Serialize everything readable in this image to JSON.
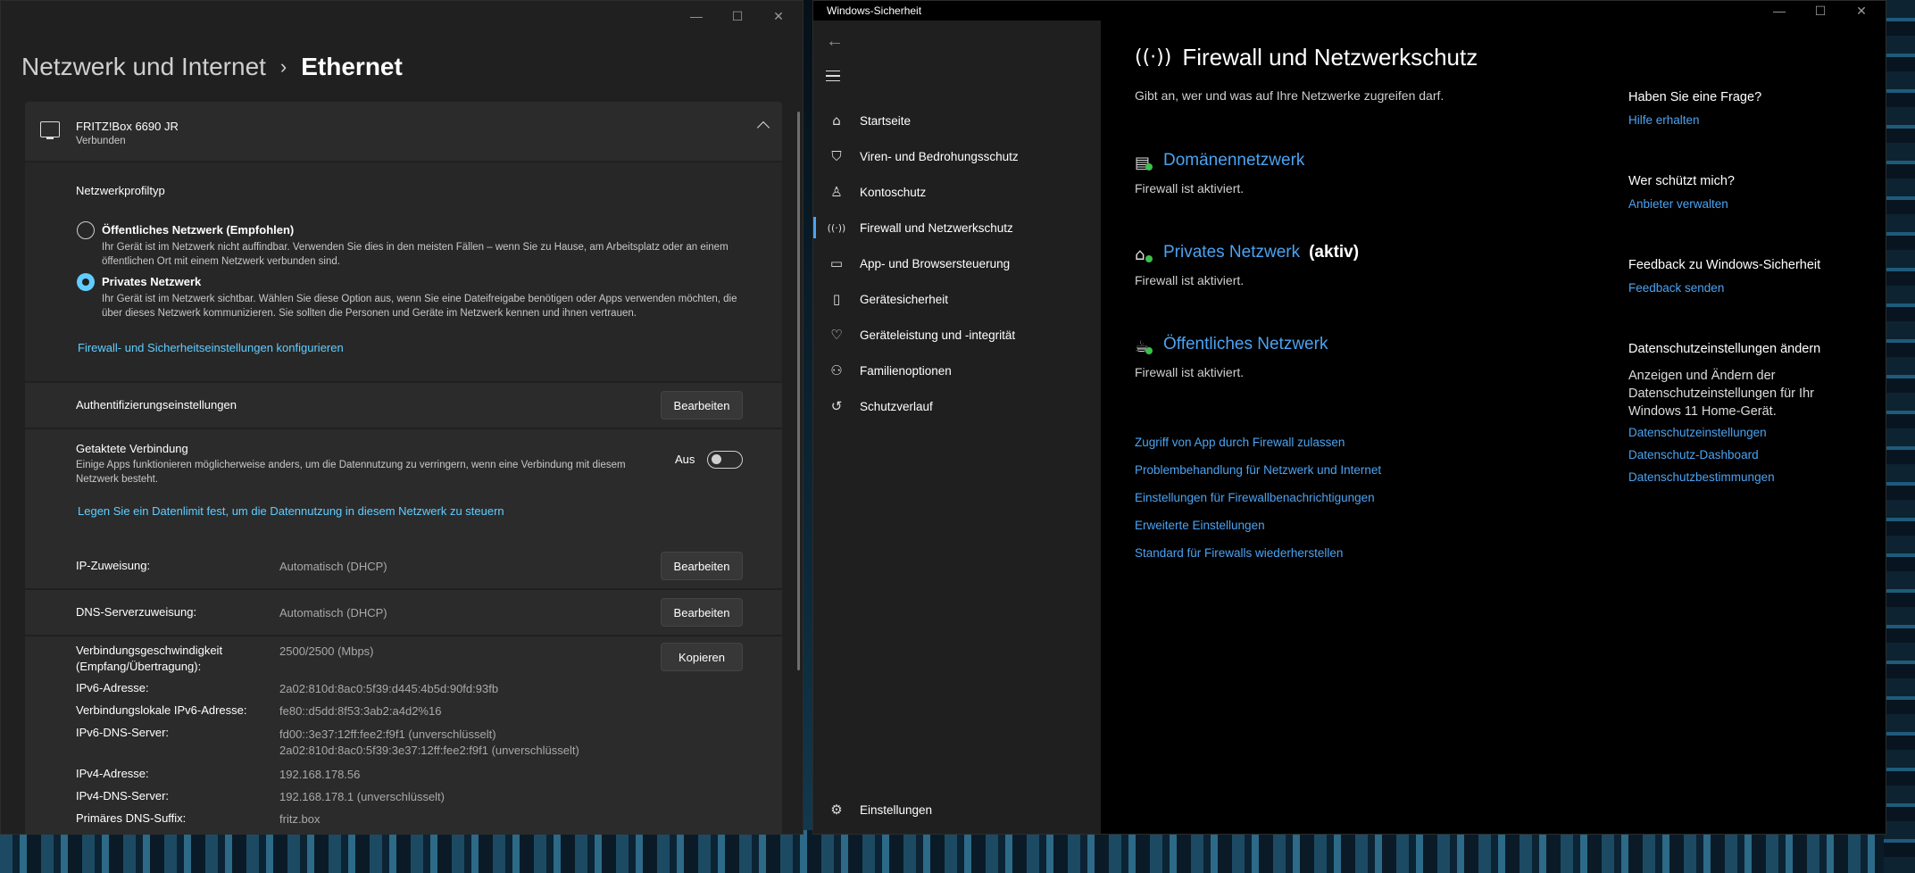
{
  "settings": {
    "breadcrumb_parent": "Netzwerk und Internet",
    "breadcrumb_sep": "›",
    "breadcrumb_current": "Ethernet",
    "caption": {
      "minimize": "—",
      "maximize": "☐",
      "close": "✕"
    },
    "adapter": {
      "name": "FRITZ!Box 6690 JR",
      "status": "Verbunden"
    },
    "profile": {
      "heading": "Netzwerkprofiltyp",
      "options": [
        {
          "title": "Öffentliches Netzwerk (Empfohlen)",
          "desc": "Ihr Gerät ist im Netzwerk nicht auffindbar. Verwenden Sie dies in den meisten Fällen – wenn Sie zu Hause, am Arbeitsplatz oder an einem öffentlichen Ort mit einem Netzwerk verbunden sind.",
          "selected": false
        },
        {
          "title": "Privates Netzwerk",
          "desc": "Ihr Gerät ist im Netzwerk sichtbar. Wählen Sie diese Option aus, wenn Sie eine Dateifreigabe benötigen oder Apps verwenden möchten, die über dieses Netzwerk kommunizieren. Sie sollten die Personen und Geräte im Netzwerk kennen und ihnen vertrauen.",
          "selected": true
        }
      ],
      "firewall_link": "Firewall- und Sicherheitseinstellungen konfigurieren"
    },
    "auth": {
      "label": "Authentifizierungseinstellungen",
      "button": "Bearbeiten"
    },
    "metered": {
      "label": "Getaktete Verbindung",
      "desc": "Einige Apps funktionieren möglicherweise anders, um die Datennutzung zu verringern, wenn eine Verbindung mit diesem Netzwerk besteht.",
      "toggle_label": "Aus",
      "toggle_on": false,
      "link": "Legen Sie ein Datenlimit fest, um die Datennutzung in diesem Netzwerk zu steuern"
    },
    "ip": {
      "label": "IP-Zuweisung:",
      "value": "Automatisch (DHCP)",
      "button": "Bearbeiten"
    },
    "dns": {
      "label": "DNS-Serverzuweisung:",
      "value": "Automatisch (DHCP)",
      "button": "Bearbeiten"
    },
    "props": {
      "copy_button": "Kopieren",
      "speed_label_1": "Verbindungsgeschwindigkeit",
      "speed_label_2": "(Empfang/Übertragung):",
      "speed_value": "2500/2500 (Mbps)",
      "ipv6_label": "IPv6-Adresse:",
      "ipv6_value": "2a02:810d:8ac0:5f39:d445:4b5d:90fd:93fb",
      "ll_label": "Verbindungslokale IPv6-Adresse:",
      "ll_value": "fe80::d5dd:8f53:3ab2:a4d2%16",
      "dns6_label": "IPv6-DNS-Server:",
      "dns6_value_1": "fd00::3e37:12ff:fee2:f9f1 (unverschlüsselt)",
      "dns6_value_2": "2a02:810d:8ac0:5f39:3e37:12ff:fee2:f9f1 (unverschlüsselt)",
      "ipv4_label": "IPv4-Adresse:",
      "ipv4_value": "192.168.178.56",
      "dns4_label": "IPv4-DNS-Server:",
      "dns4_value": "192.168.178.1 (unverschlüsselt)",
      "suffix_label": "Primäres DNS-Suffix:",
      "suffix_value": "fritz.box"
    }
  },
  "security": {
    "window_title": "Windows-Sicherheit",
    "nav": [
      {
        "label": "Startseite",
        "icon": "home-icon",
        "glyph": "⌂"
      },
      {
        "label": "Viren- und Bedrohungsschutz",
        "icon": "shield-icon",
        "glyph": "⛉"
      },
      {
        "label": "Kontoschutz",
        "icon": "person-icon",
        "glyph": "♙"
      },
      {
        "label": "Firewall und Netzwerkschutz",
        "icon": "antenna-icon",
        "glyph": "((·))"
      },
      {
        "label": "App- und Browsersteuerung",
        "icon": "browser-window-icon",
        "glyph": "▭"
      },
      {
        "label": "Gerätesicherheit",
        "icon": "device-icon",
        "glyph": "▯"
      },
      {
        "label": "Geräteleistung und -integrität",
        "icon": "heart-icon",
        "glyph": "♡"
      },
      {
        "label": "Familienoptionen",
        "icon": "family-icon",
        "glyph": "⚇"
      },
      {
        "label": "Schutzverlauf",
        "icon": "history-icon",
        "glyph": "↺"
      }
    ],
    "settings_label": "Einstellungen",
    "page_title": "Firewall und Netzwerkschutz",
    "page_subtitle": "Gibt an, wer und was auf Ihre Netzwerke zugreifen darf.",
    "networks": [
      {
        "name": "Domänennetzwerk",
        "active_tag": "",
        "state": "Firewall ist aktiviert.",
        "icon": "domain-network-icon"
      },
      {
        "name": "Privates Netzwerk",
        "active_tag": "(aktiv)",
        "state": "Firewall ist aktiviert.",
        "icon": "private-network-icon"
      },
      {
        "name": "Öffentliches Netzwerk",
        "active_tag": "",
        "state": "Firewall ist aktiviert.",
        "icon": "public-network-icon"
      }
    ],
    "links": [
      "Zugriff von App durch Firewall zulassen",
      "Problembehandlung für Netzwerk und Internet",
      "Einstellungen für Firewallbenachrichtigungen",
      "Erweiterte Einstellungen",
      "Standard für Firewalls wiederherstellen"
    ],
    "side": {
      "q_heading": "Haben Sie eine Frage?",
      "q_link": "Hilfe erhalten",
      "who_heading": "Wer schützt mich?",
      "who_link": "Anbieter verwalten",
      "fb_heading": "Feedback zu Windows-Sicherheit",
      "fb_link": "Feedback senden",
      "privacy_heading": "Datenschutzeinstellungen ändern",
      "privacy_text": "Anzeigen und Ändern der Datenschutzeinstellungen für Ihr Windows 11 Home-Gerät.",
      "privacy_links": [
        "Datenschutzeinstellungen",
        "Datenschutz-Dashboard",
        "Datenschutzbestimmungen"
      ]
    }
  }
}
